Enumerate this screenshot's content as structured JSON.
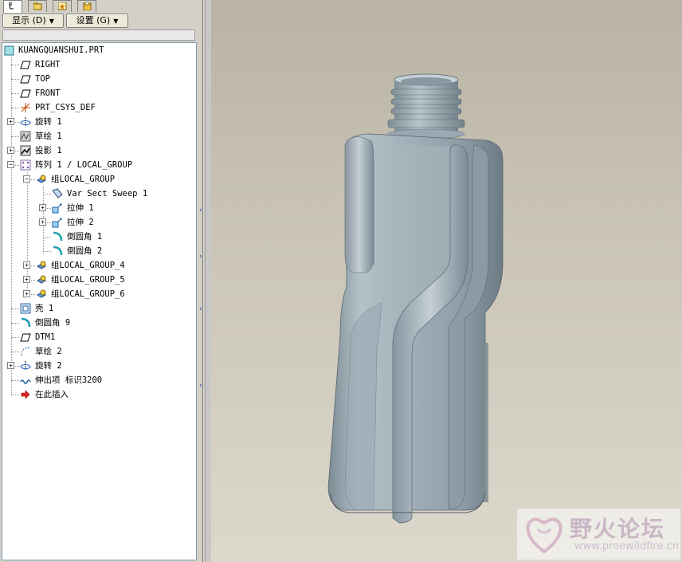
{
  "tabs": [
    {
      "icon": "model-tree-icon"
    },
    {
      "icon": "folder-browser-icon"
    },
    {
      "icon": "favorites-icon"
    },
    {
      "icon": "history-icon"
    }
  ],
  "menu": {
    "display_label": "显示 (D)",
    "settings_label": "设置 (G)"
  },
  "tree": {
    "root": "KUANGQUANSHUI.PRT",
    "items": [
      {
        "label": "RIGHT",
        "icon": "datum-plane-icon"
      },
      {
        "label": "TOP",
        "icon": "datum-plane-icon"
      },
      {
        "label": "FRONT",
        "icon": "datum-plane-icon"
      },
      {
        "label": "PRT_CSYS_DEF",
        "icon": "coordinate-system-icon"
      },
      {
        "label": "旋转 1",
        "icon": "revolve-icon"
      },
      {
        "label": "草绘 1",
        "icon": "sketch-icon"
      },
      {
        "label": "投影 1",
        "icon": "projection-icon"
      },
      {
        "label": "阵列 1 / LOCAL_GROUP",
        "icon": "pattern-icon"
      },
      {
        "label": "组LOCAL_GROUP",
        "icon": "group-icon"
      },
      {
        "label": "Var Sect Sweep 1",
        "icon": "sweep-icon"
      },
      {
        "label": "拉伸 1",
        "icon": "extrude-icon"
      },
      {
        "label": "拉伸 2",
        "icon": "extrude-icon"
      },
      {
        "label": "倒圆角 1",
        "icon": "round-icon"
      },
      {
        "label": "倒圆角 2",
        "icon": "round-icon"
      },
      {
        "label": "组LOCAL_GROUP_4",
        "icon": "group-icon"
      },
      {
        "label": "组LOCAL_GROUP_5",
        "icon": "group-icon"
      },
      {
        "label": "组LOCAL_GROUP_6",
        "icon": "group-icon"
      },
      {
        "label": "壳 1",
        "icon": "shell-icon"
      },
      {
        "label": "倒圆角 9",
        "icon": "round-icon"
      },
      {
        "label": "DTM1",
        "icon": "datum-plane-icon"
      },
      {
        "label": "草绘 2",
        "icon": "sketch-icon"
      },
      {
        "label": "旋转 2",
        "icon": "revolve-icon"
      },
      {
        "label": "伸出项 标识3200",
        "icon": "protrusion-icon"
      },
      {
        "label": "在此插入",
        "icon": "insert-here-icon"
      }
    ]
  },
  "watermark": {
    "title": "野火论坛",
    "url": "www.proewildfire.cn"
  }
}
